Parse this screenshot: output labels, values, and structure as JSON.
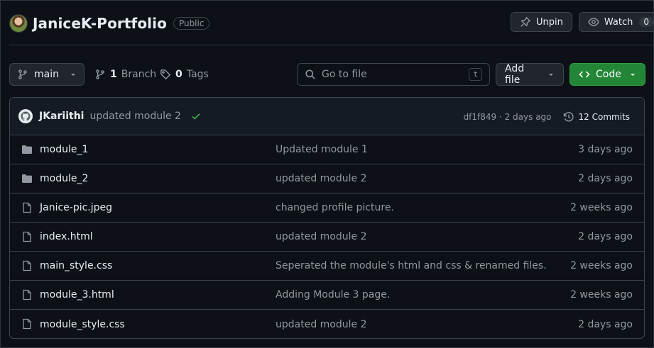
{
  "repo": {
    "owner_avatar": "avatar",
    "name": "JaniceK-Portfolio",
    "visibility": "Public"
  },
  "actions": {
    "unpin_label": "Unpin",
    "watch_label": "Watch",
    "watch_count": "0"
  },
  "toolbar": {
    "branch": "main",
    "branch_count": "1",
    "branch_label": "Branch",
    "tag_count": "0",
    "tag_label": "Tags",
    "goto_placeholder": "Go to file",
    "goto_shortcut": "t",
    "add_file_label": "Add file",
    "code_label": "Code"
  },
  "commit": {
    "author": "JKariithi",
    "message": "updated module 2",
    "hash_time": "df1f849 · 2 days ago",
    "commits_label": "12 Commits"
  },
  "files": [
    {
      "type": "folder",
      "name": "module_1",
      "message": "Updated module 1",
      "date": "3 days ago"
    },
    {
      "type": "folder",
      "name": "module_2",
      "message": "updated module 2",
      "date": "2 days ago"
    },
    {
      "type": "file",
      "name": "Janice-pic.jpeg",
      "message": "changed profile picture.",
      "date": "2 weeks ago"
    },
    {
      "type": "file",
      "name": "index.html",
      "message": "updated module 2",
      "date": "2 days ago"
    },
    {
      "type": "file",
      "name": "main_style.css",
      "message": "Seperated the module's html and css & renamed files.",
      "date": "2 weeks ago"
    },
    {
      "type": "file",
      "name": "module_3.html",
      "message": "Adding Module 3 page.",
      "date": "2 weeks ago"
    },
    {
      "type": "file",
      "name": "module_style.css",
      "message": "updated module 2",
      "date": "2 days ago"
    }
  ],
  "colors": {
    "background": "#0d1117",
    "accent_green": "#238636",
    "check_green": "#3fb950",
    "muted_text": "#9198a1",
    "border": "#3d444d"
  }
}
